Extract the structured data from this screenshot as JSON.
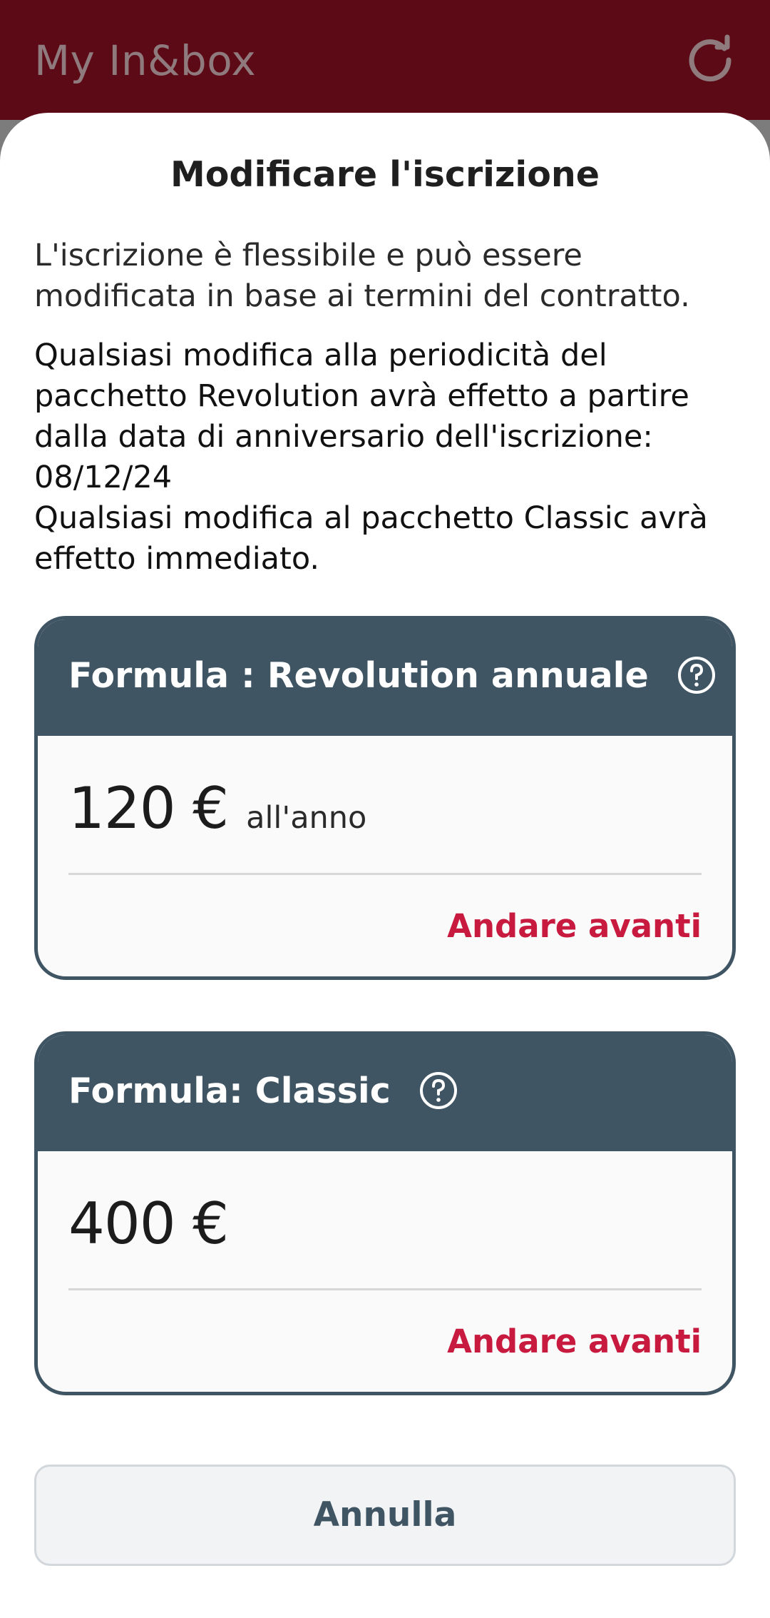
{
  "header": {
    "title": "My In&box",
    "refresh_icon": "refresh-icon"
  },
  "sheet": {
    "title": "Modificare l'iscrizione",
    "intro": "L'iscrizione è flessibile e può essere modificata in base ai termini del contratto.",
    "notice_line_1": "Qualsiasi modifica alla periodicità del pacchetto Revolution avrà effetto a partire dalla data di anniversario dell'iscrizione: 08/12/24",
    "notice_line_2": "Qualsiasi modifica al pacchetto Classic avrà effetto immediato."
  },
  "plans": [
    {
      "title": "Formula : Revolution annuale",
      "price": "120 €",
      "period": "all'anno",
      "action": "Andare avanti",
      "help_icon": "help-circle-icon"
    },
    {
      "title": "Formula: Classic",
      "price": "400 €",
      "period": "",
      "action": "Andare avanti",
      "help_icon": "help-circle-icon"
    }
  ],
  "footer": {
    "cancel_label": "Annulla"
  },
  "colors": {
    "header_bg": "#5d0a17",
    "card_header": "#405563",
    "accent": "#c8193f"
  }
}
